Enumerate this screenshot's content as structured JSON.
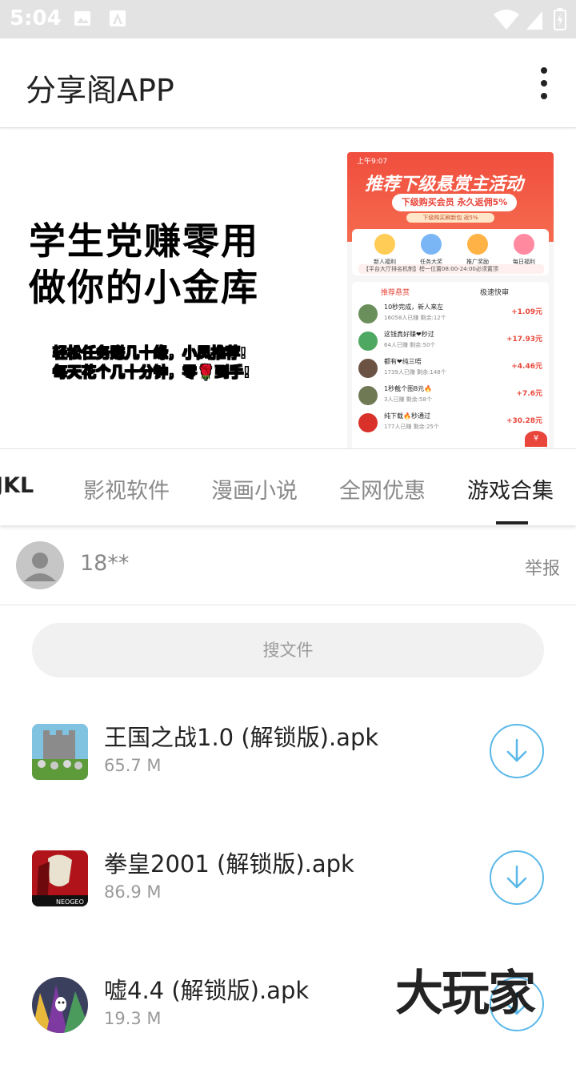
{
  "status_bar": {
    "time": "5:04"
  },
  "app_bar": {
    "title": "分享阁APP"
  },
  "banner": {
    "headline_line1": "学生党赚零用",
    "headline_line2": "做你的小金库",
    "sub_line1": "轻松任务赚几十缘，小凤推荐!",
    "sub_line2": "每天花个几十分钟，零🌹到手!",
    "phone": {
      "status": "上午9:07",
      "head": "推荐下级悬赏主活动",
      "pill": "下级购买会员  永久返佣5%",
      "pill2": "下级购买刷新包  返5%",
      "icons": [
        "新人福利",
        "任务大奖",
        "推广奖励",
        "每日福利"
      ],
      "notice": "【平台大厅排名机制】榜一位置08:00-24:00必须置顶",
      "tab1": "推荐悬赏",
      "tab2": "极速快审",
      "rows": [
        {
          "title": "10秒完成，新人来左",
          "meta": "16058人已赚  剩余:12个",
          "amount": "+1.09元"
        },
        {
          "title": "这钱真好赚❤秒过",
          "meta": "64人已赚  剩余:50个",
          "amount": "+17.93元"
        },
        {
          "title": "都有❤纯三唔",
          "meta": "1739人已赚  剩余:148个",
          "amount": "+4.46元"
        },
        {
          "title": "1秒截个图8元🔥",
          "meta": "3人已赚  剩余:58个",
          "amount": "+7.6元"
        },
        {
          "title": "纯下载🔥秒通过",
          "meta": "177人已赚  剩余:25个",
          "amount": "+30.28元"
        }
      ]
    }
  },
  "tabs": {
    "items": [
      "JKL",
      "影视软件",
      "漫画小说",
      "全网优惠",
      "游戏合集"
    ],
    "active_index": 4
  },
  "user": {
    "name": "18**",
    "report_label": "举报"
  },
  "search": {
    "placeholder": "搜文件"
  },
  "files": [
    {
      "name": "王国之战1.0 (解锁版).apk",
      "size": "65.7 M",
      "icon": "game-thumb-kingdom"
    },
    {
      "name": "拳皇2001 (解锁版).apk",
      "size": "86.9 M",
      "icon": "game-thumb-kof"
    },
    {
      "name": "嘘4.4 (解锁版).apk",
      "size": "19.3 M",
      "icon": "game-thumb-shh"
    }
  ],
  "watermark": "大玩家",
  "colors": {
    "accent": "#5ab8e8",
    "banner_red": "#f04e3e",
    "status_bar": "#e3e3e3"
  }
}
